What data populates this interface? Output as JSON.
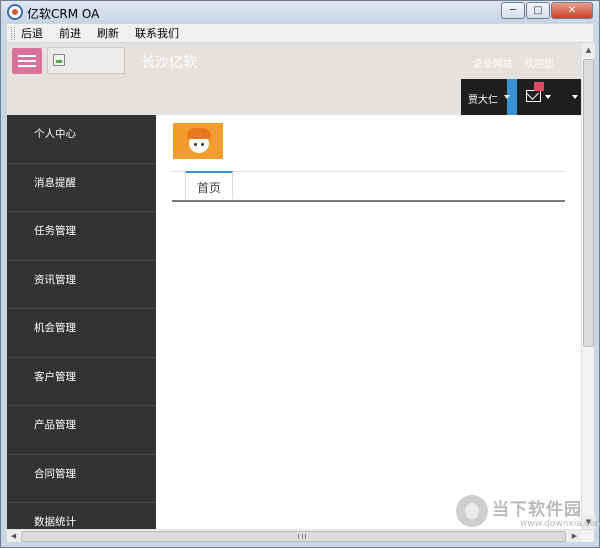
{
  "window": {
    "title": "亿软CRM OA",
    "minimize": "─",
    "maximize": "□",
    "close": "✕"
  },
  "menu": {
    "items": [
      "后退",
      "前进",
      "刷新",
      "联系我们"
    ]
  },
  "header": {
    "brand": "长沙亿软",
    "link_site": "企业网站",
    "link_welcome": "欢迎您",
    "user_name": "贾大仁"
  },
  "sidebar": {
    "items": [
      "个人中心",
      "消息提醒",
      "任务管理",
      "资讯管理",
      "机会管理",
      "客户管理",
      "产品管理",
      "合同管理",
      "数据统计"
    ]
  },
  "content": {
    "tab_home": "首页"
  },
  "scrollbar": {
    "up": "▲",
    "down": "▼",
    "left": "◀",
    "right": "▶"
  },
  "watermark": {
    "text": "当下软件园",
    "url": "www.downxia.com"
  },
  "colors": {
    "menu_button": "#d9739a",
    "sidebar": "#333333",
    "accent": "#3a92d0",
    "badge": "#e04864",
    "avatar_bg": "#f39c2e"
  }
}
